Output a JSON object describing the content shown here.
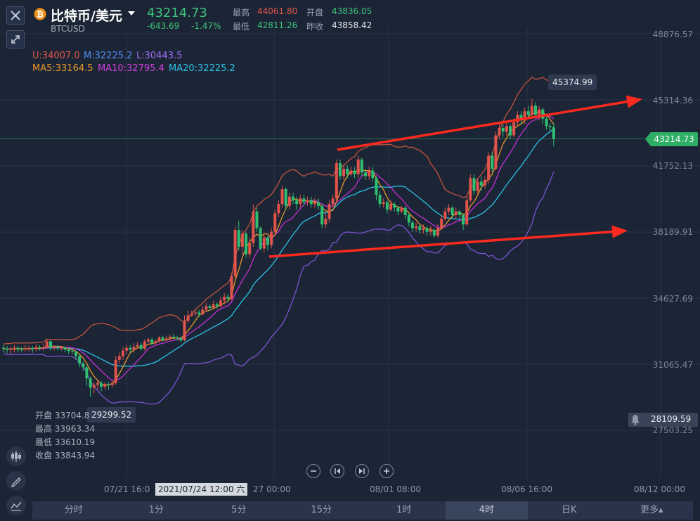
{
  "header": {
    "pair_name": "比特币/美元",
    "symbol": "BTCUSD",
    "last_price": "43214.73",
    "change": "-643.69",
    "change_pct": "-1.47%",
    "high_label": "最高",
    "high_value": "44061.80",
    "open_label": "开盘",
    "open_value": "43836.05",
    "low_label": "最低",
    "low_value": "42811.26",
    "prev_close_label": "昨收",
    "prev_close_value": "43858.42"
  },
  "indicators": {
    "boll_upper": "U:34007.0",
    "boll_mid": "M:32225.2",
    "boll_lower": "L:30443.5",
    "ma5": "MA5:33164.5",
    "ma10": "MA10:32795.4",
    "ma20": "MA20:32225.2"
  },
  "price_axis": [
    "48876.57",
    "45314.36",
    "41752.13",
    "38189.91",
    "34627.69",
    "31065.47",
    "27503.25"
  ],
  "current_price_tag": "43214.73",
  "alert_price": "28109.59",
  "annotations": {
    "peak_label": "45374.99",
    "trough_label": "29299.52"
  },
  "crosshair_info": {
    "open": "开盘 33704.8",
    "high": "最高 33963.34",
    "low": "最低 33610.19",
    "close": "收盘 33843.94"
  },
  "time_axis": {
    "labels": [
      "07/21 16:0",
      "27 00:00",
      "08/01 08:00",
      "08/06 16:00",
      "08/12 00:00"
    ],
    "crosshair_time": "2021/07/24 12:00 六"
  },
  "period_tabs": [
    {
      "label": "分时",
      "active": false
    },
    {
      "label": "1分",
      "active": false
    },
    {
      "label": "5分",
      "active": false
    },
    {
      "label": "15分",
      "active": false
    },
    {
      "label": "1时",
      "active": false
    },
    {
      "label": "4时",
      "active": true
    },
    {
      "label": "日K",
      "active": false
    },
    {
      "label": "更多▴",
      "active": false
    }
  ],
  "colors": {
    "up": "#e0544b",
    "down": "#2fbf71",
    "boll_upper": "#c0533e",
    "boll_lower": "#7b53d6",
    "ma5": "#e8962b",
    "ma10": "#c22fd4",
    "ma20": "#2bc1e6",
    "trend_arrow": "#ff2a1f"
  },
  "icons": [
    "close-icon",
    "bitcoin-icon",
    "dropdown-caret-icon",
    "expand-icon",
    "candles-icon",
    "draw-pen-icon",
    "indicator-icon",
    "zoom-out-icon",
    "prev-icon",
    "next-icon",
    "zoom-in-icon",
    "bell-icon"
  ],
  "chart_data": {
    "type": "candlestick",
    "symbol": "BTCUSD",
    "interval": "4时",
    "ylim": [
      27503.25,
      48876.57
    ],
    "candles": [
      {
        "o": 31950,
        "c": 31900,
        "h": 32100,
        "l": 31700
      },
      {
        "o": 31900,
        "c": 31850,
        "h": 32050,
        "l": 31650
      },
      {
        "o": 31850,
        "c": 31900,
        "h": 32000,
        "l": 31600
      },
      {
        "o": 31900,
        "c": 31950,
        "h": 32100,
        "l": 31700
      },
      {
        "o": 31950,
        "c": 31880,
        "h": 32050,
        "l": 31700
      },
      {
        "o": 31880,
        "c": 31870,
        "h": 32000,
        "l": 31700
      },
      {
        "o": 31870,
        "c": 31920,
        "h": 32100,
        "l": 31750
      },
      {
        "o": 31920,
        "c": 31940,
        "h": 32080,
        "l": 31750
      },
      {
        "o": 31940,
        "c": 31880,
        "h": 32050,
        "l": 31680
      },
      {
        "o": 31880,
        "c": 31980,
        "h": 32150,
        "l": 31750
      },
      {
        "o": 31980,
        "c": 31950,
        "h": 32100,
        "l": 31800
      },
      {
        "o": 31950,
        "c": 31980,
        "h": 32150,
        "l": 31800
      },
      {
        "o": 31980,
        "c": 32300,
        "h": 32400,
        "l": 31900
      },
      {
        "o": 32300,
        "c": 31950,
        "h": 32350,
        "l": 31800
      },
      {
        "o": 31950,
        "c": 31980,
        "h": 32100,
        "l": 31800
      },
      {
        "o": 31980,
        "c": 31930,
        "h": 32100,
        "l": 31800
      },
      {
        "o": 31930,
        "c": 31960,
        "h": 32050,
        "l": 31800
      },
      {
        "o": 31960,
        "c": 31850,
        "h": 32000,
        "l": 31700
      },
      {
        "o": 31850,
        "c": 31780,
        "h": 31950,
        "l": 31600
      },
      {
        "o": 31780,
        "c": 31750,
        "h": 31900,
        "l": 31600
      },
      {
        "o": 31750,
        "c": 31500,
        "h": 31800,
        "l": 31300
      },
      {
        "o": 31500,
        "c": 31100,
        "h": 31600,
        "l": 30900
      },
      {
        "o": 31100,
        "c": 30900,
        "h": 31200,
        "l": 30700
      },
      {
        "o": 30900,
        "c": 30300,
        "h": 31000,
        "l": 29900
      },
      {
        "o": 30300,
        "c": 29800,
        "h": 30400,
        "l": 29300
      },
      {
        "o": 29800,
        "c": 29950,
        "h": 30100,
        "l": 29500
      },
      {
        "o": 29950,
        "c": 30050,
        "h": 30200,
        "l": 29700
      },
      {
        "o": 30050,
        "c": 29850,
        "h": 30150,
        "l": 29600
      },
      {
        "o": 29850,
        "c": 30000,
        "h": 30100,
        "l": 29700
      },
      {
        "o": 30000,
        "c": 29950,
        "h": 30100,
        "l": 29700
      },
      {
        "o": 29950,
        "c": 30050,
        "h": 30200,
        "l": 29800
      },
      {
        "o": 30050,
        "c": 31300,
        "h": 31500,
        "l": 29950
      },
      {
        "o": 31300,
        "c": 31500,
        "h": 31700,
        "l": 31100
      },
      {
        "o": 31500,
        "c": 31800,
        "h": 32000,
        "l": 31300
      },
      {
        "o": 31800,
        "c": 31950,
        "h": 32100,
        "l": 31600
      },
      {
        "o": 31950,
        "c": 31850,
        "h": 32100,
        "l": 31700
      },
      {
        "o": 31850,
        "c": 32000,
        "h": 32200,
        "l": 31700
      },
      {
        "o": 32000,
        "c": 32100,
        "h": 32250,
        "l": 31900
      },
      {
        "o": 32100,
        "c": 31900,
        "h": 32200,
        "l": 31800
      },
      {
        "o": 31900,
        "c": 32300,
        "h": 32400,
        "l": 31800
      },
      {
        "o": 32300,
        "c": 32400,
        "h": 32500,
        "l": 32200
      },
      {
        "o": 32400,
        "c": 32200,
        "h": 32500,
        "l": 32100
      },
      {
        "o": 32200,
        "c": 32300,
        "h": 32400,
        "l": 32100
      },
      {
        "o": 32300,
        "c": 32500,
        "h": 32600,
        "l": 32200
      },
      {
        "o": 32500,
        "c": 32400,
        "h": 32600,
        "l": 32300
      },
      {
        "o": 32400,
        "c": 32450,
        "h": 32600,
        "l": 32300
      },
      {
        "o": 32450,
        "c": 32550,
        "h": 32650,
        "l": 32350
      },
      {
        "o": 32550,
        "c": 32500,
        "h": 32700,
        "l": 32400
      },
      {
        "o": 32500,
        "c": 32450,
        "h": 32600,
        "l": 32350
      },
      {
        "o": 32450,
        "c": 32350,
        "h": 32550,
        "l": 32250
      },
      {
        "o": 32350,
        "c": 33400,
        "h": 33700,
        "l": 32300
      },
      {
        "o": 33400,
        "c": 33700,
        "h": 33950,
        "l": 33300
      },
      {
        "o": 33700,
        "c": 33800,
        "h": 33960,
        "l": 33610
      },
      {
        "o": 33800,
        "c": 33850,
        "h": 34000,
        "l": 33650
      },
      {
        "o": 33850,
        "c": 33750,
        "h": 34000,
        "l": 33600
      },
      {
        "o": 33750,
        "c": 34000,
        "h": 34200,
        "l": 33700
      },
      {
        "o": 34000,
        "c": 34200,
        "h": 34400,
        "l": 33900
      },
      {
        "o": 34200,
        "c": 34100,
        "h": 34300,
        "l": 33950
      },
      {
        "o": 34100,
        "c": 34300,
        "h": 34500,
        "l": 34000
      },
      {
        "o": 34300,
        "c": 34200,
        "h": 34400,
        "l": 34050
      },
      {
        "o": 34200,
        "c": 34500,
        "h": 34700,
        "l": 34100
      },
      {
        "o": 34500,
        "c": 34700,
        "h": 34900,
        "l": 34300
      },
      {
        "o": 34700,
        "c": 34600,
        "h": 34850,
        "l": 34400
      },
      {
        "o": 34600,
        "c": 35800,
        "h": 36000,
        "l": 34500
      },
      {
        "o": 35800,
        "c": 38300,
        "h": 38500,
        "l": 35700
      },
      {
        "o": 38300,
        "c": 37400,
        "h": 38800,
        "l": 37200
      },
      {
        "o": 37400,
        "c": 38100,
        "h": 38300,
        "l": 37000
      },
      {
        "o": 38100,
        "c": 37000,
        "h": 38200,
        "l": 36800
      },
      {
        "o": 37000,
        "c": 37600,
        "h": 37900,
        "l": 36800
      },
      {
        "o": 37600,
        "c": 39300,
        "h": 39700,
        "l": 37400
      },
      {
        "o": 39300,
        "c": 38400,
        "h": 39500,
        "l": 38200
      },
      {
        "o": 38400,
        "c": 37300,
        "h": 38500,
        "l": 37200
      },
      {
        "o": 37300,
        "c": 37900,
        "h": 38100,
        "l": 37100
      },
      {
        "o": 37900,
        "c": 37500,
        "h": 38000,
        "l": 37200
      },
      {
        "o": 37500,
        "c": 38200,
        "h": 38400,
        "l": 37300
      },
      {
        "o": 38200,
        "c": 39200,
        "h": 39400,
        "l": 38000
      },
      {
        "o": 39200,
        "c": 39700,
        "h": 39900,
        "l": 39000
      },
      {
        "o": 39700,
        "c": 40500,
        "h": 40700,
        "l": 39500
      },
      {
        "o": 40500,
        "c": 39600,
        "h": 40600,
        "l": 39400
      },
      {
        "o": 39600,
        "c": 40100,
        "h": 40300,
        "l": 39400
      },
      {
        "o": 40100,
        "c": 39900,
        "h": 40300,
        "l": 39700
      },
      {
        "o": 39900,
        "c": 39700,
        "h": 40100,
        "l": 39400
      },
      {
        "o": 39700,
        "c": 40000,
        "h": 40200,
        "l": 39500
      },
      {
        "o": 40000,
        "c": 39800,
        "h": 40200,
        "l": 39600
      },
      {
        "o": 39800,
        "c": 39900,
        "h": 40100,
        "l": 39600
      },
      {
        "o": 39900,
        "c": 39700,
        "h": 40100,
        "l": 39500
      },
      {
        "o": 39700,
        "c": 39800,
        "h": 40000,
        "l": 39500
      },
      {
        "o": 39800,
        "c": 39600,
        "h": 40000,
        "l": 39400
      },
      {
        "o": 39600,
        "c": 38600,
        "h": 39700,
        "l": 38400
      },
      {
        "o": 38600,
        "c": 38900,
        "h": 39200,
        "l": 38400
      },
      {
        "o": 38900,
        "c": 39700,
        "h": 39900,
        "l": 38700
      },
      {
        "o": 39700,
        "c": 40000,
        "h": 40200,
        "l": 39500
      },
      {
        "o": 40000,
        "c": 41900,
        "h": 42100,
        "l": 39800
      },
      {
        "o": 41900,
        "c": 41200,
        "h": 42100,
        "l": 41000
      },
      {
        "o": 41200,
        "c": 41600,
        "h": 41800,
        "l": 41000
      },
      {
        "o": 41600,
        "c": 41300,
        "h": 41800,
        "l": 41100
      },
      {
        "o": 41300,
        "c": 41500,
        "h": 41700,
        "l": 41200
      },
      {
        "o": 41500,
        "c": 41300,
        "h": 41700,
        "l": 41100
      },
      {
        "o": 41300,
        "c": 42100,
        "h": 42300,
        "l": 41100
      },
      {
        "o": 42100,
        "c": 41400,
        "h": 42200,
        "l": 41200
      },
      {
        "o": 41400,
        "c": 41200,
        "h": 41600,
        "l": 41000
      },
      {
        "o": 41200,
        "c": 41500,
        "h": 41700,
        "l": 41000
      },
      {
        "o": 41500,
        "c": 41100,
        "h": 41700,
        "l": 40900
      },
      {
        "o": 41100,
        "c": 40200,
        "h": 41200,
        "l": 39900
      },
      {
        "o": 40200,
        "c": 39700,
        "h": 40400,
        "l": 39500
      },
      {
        "o": 39700,
        "c": 39800,
        "h": 40000,
        "l": 39500
      },
      {
        "o": 39800,
        "c": 39400,
        "h": 39900,
        "l": 39200
      },
      {
        "o": 39400,
        "c": 39700,
        "h": 39900,
        "l": 39300
      },
      {
        "o": 39700,
        "c": 39500,
        "h": 39800,
        "l": 39300
      },
      {
        "o": 39500,
        "c": 39300,
        "h": 39600,
        "l": 39100
      },
      {
        "o": 39300,
        "c": 39500,
        "h": 39600,
        "l": 39200
      },
      {
        "o": 39500,
        "c": 39100,
        "h": 39600,
        "l": 38900
      },
      {
        "o": 39100,
        "c": 38700,
        "h": 39200,
        "l": 38500
      },
      {
        "o": 38700,
        "c": 38400,
        "h": 38800,
        "l": 38200
      },
      {
        "o": 38400,
        "c": 38500,
        "h": 38700,
        "l": 38200
      },
      {
        "o": 38500,
        "c": 38300,
        "h": 38600,
        "l": 38100
      },
      {
        "o": 38300,
        "c": 38400,
        "h": 38600,
        "l": 38100
      },
      {
        "o": 38400,
        "c": 38200,
        "h": 38500,
        "l": 38000
      },
      {
        "o": 38200,
        "c": 38300,
        "h": 38500,
        "l": 38000
      },
      {
        "o": 38300,
        "c": 38000,
        "h": 38400,
        "l": 37900
      },
      {
        "o": 38000,
        "c": 38400,
        "h": 38600,
        "l": 37900
      },
      {
        "o": 38400,
        "c": 38900,
        "h": 39100,
        "l": 38300
      },
      {
        "o": 38900,
        "c": 39300,
        "h": 39500,
        "l": 38800
      },
      {
        "o": 39300,
        "c": 39500,
        "h": 39700,
        "l": 39100
      },
      {
        "o": 39500,
        "c": 39100,
        "h": 39600,
        "l": 38900
      },
      {
        "o": 39100,
        "c": 39300,
        "h": 39500,
        "l": 38900
      },
      {
        "o": 39300,
        "c": 39100,
        "h": 39400,
        "l": 38900
      },
      {
        "o": 39100,
        "c": 38600,
        "h": 39200,
        "l": 38300
      },
      {
        "o": 38600,
        "c": 39900,
        "h": 40100,
        "l": 38500
      },
      {
        "o": 39900,
        "c": 41100,
        "h": 41300,
        "l": 39800
      },
      {
        "o": 41100,
        "c": 40400,
        "h": 41300,
        "l": 40200
      },
      {
        "o": 40400,
        "c": 40900,
        "h": 41100,
        "l": 40200
      },
      {
        "o": 40900,
        "c": 40700,
        "h": 41200,
        "l": 40400
      },
      {
        "o": 40700,
        "c": 41000,
        "h": 41200,
        "l": 40500
      },
      {
        "o": 41000,
        "c": 42300,
        "h": 42500,
        "l": 40800
      },
      {
        "o": 42300,
        "c": 41600,
        "h": 42500,
        "l": 41400
      },
      {
        "o": 41600,
        "c": 43400,
        "h": 43600,
        "l": 41500
      },
      {
        "o": 43400,
        "c": 43800,
        "h": 44100,
        "l": 43200
      },
      {
        "o": 43800,
        "c": 43600,
        "h": 44000,
        "l": 43300
      },
      {
        "o": 43600,
        "c": 43900,
        "h": 44100,
        "l": 43400
      },
      {
        "o": 43900,
        "c": 43400,
        "h": 44000,
        "l": 43200
      },
      {
        "o": 43400,
        "c": 44100,
        "h": 44300,
        "l": 43300
      },
      {
        "o": 44100,
        "c": 44500,
        "h": 44700,
        "l": 43900
      },
      {
        "o": 44500,
        "c": 44200,
        "h": 44700,
        "l": 44000
      },
      {
        "o": 44200,
        "c": 44700,
        "h": 44900,
        "l": 44000
      },
      {
        "o": 44700,
        "c": 44500,
        "h": 45000,
        "l": 44300
      },
      {
        "o": 44500,
        "c": 45000,
        "h": 45375,
        "l": 44400
      },
      {
        "o": 45000,
        "c": 44500,
        "h": 45200,
        "l": 44300
      },
      {
        "o": 44500,
        "c": 44800,
        "h": 45000,
        "l": 44200
      },
      {
        "o": 44800,
        "c": 44300,
        "h": 44900,
        "l": 44000
      },
      {
        "o": 44300,
        "c": 43900,
        "h": 44400,
        "l": 43700
      },
      {
        "o": 43900,
        "c": 43836,
        "h": 44061,
        "l": 43600
      },
      {
        "o": 43836,
        "c": 43215,
        "h": 44061,
        "l": 42811
      }
    ]
  }
}
